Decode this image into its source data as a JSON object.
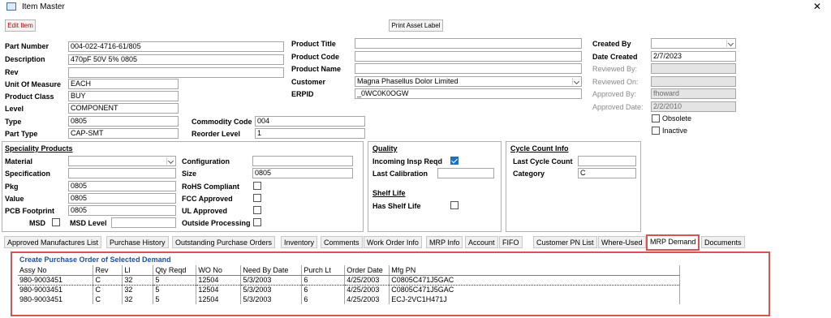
{
  "window": {
    "title": "Item Master",
    "icon": "form-icon"
  },
  "toolbar": {
    "edit_label": "Edit Item",
    "print_label": "Print Asset Label"
  },
  "item": {
    "part_number_label": "Part Number",
    "part_number": "004-022-4716-61/805",
    "description_label": "Description",
    "description": "470pF 50V 5% 0805",
    "rev_label": "Rev",
    "rev": "",
    "uom_label": "Unit Of Measure",
    "uom": "EACH",
    "product_class_label": "Product Class",
    "product_class": "BUY",
    "level_label": "Level",
    "level": "COMPONENT",
    "type_label": "Type",
    "type": "0805",
    "part_type_label": "Part Type",
    "part_type": "CAP-SMT",
    "commodity_code_label": "Commodity Code",
    "commodity_code": "004",
    "reorder_level_label": "Reorder Level",
    "reorder_level": "1"
  },
  "product": {
    "title_label": "Product Title",
    "title": "",
    "code_label": "Product Code",
    "code": "",
    "name_label": "Product Name",
    "name": "",
    "customer_label": "Customer",
    "customer": "Magna Phasellus Dolor Limited",
    "erpid_label": "ERPID",
    "erpid": "_0WC0K0OGW"
  },
  "audit": {
    "created_by_label": "Created By",
    "created_by": "",
    "date_created_label": "Date Created",
    "date_created": "2/7/2023",
    "reviewed_by_label": "Reviewed By:",
    "reviewed_by": "",
    "reviewed_on_label": "Reviewed On:",
    "reviewed_on": "",
    "approved_by_label": "Approved By:",
    "approved_by": "fhoward",
    "approved_date_label": "Approved Date:",
    "approved_date": "2/2/2010",
    "obsolete_label": "Obsolete",
    "obsolete": false,
    "inactive_label": "Inactive",
    "inactive": false
  },
  "speciality": {
    "title": "Speciality Products",
    "material_label": "Material",
    "material": "",
    "specification_label": "Specification",
    "specification": "",
    "pkg_label": "Pkg",
    "pkg": "0805",
    "value_label": "Value",
    "value": "0805",
    "pcb_footprint_label": "PCB Footprint",
    "pcb_footprint": "0805",
    "msd_label": "MSD",
    "msd": false,
    "msd_level_label": "MSD Level",
    "msd_level": "",
    "configuration_label": "Configuration",
    "configuration": "",
    "size_label": "Size",
    "size": "0805",
    "rohs_label": "RoHS Compliant",
    "rohs": false,
    "fcc_label": "FCC Approved",
    "fcc": false,
    "ul_label": "UL Approved",
    "ul": false,
    "outside_label": "Outside Processing",
    "outside": false
  },
  "quality": {
    "title": "Quality",
    "incoming_label": "Incoming Insp Reqd",
    "incoming": true,
    "last_calibration_label": "Last Calibration",
    "last_calibration": "",
    "shelf_life_title": "Shelf Life",
    "has_shelf_life_label": "Has Shelf Life",
    "has_shelf_life": false
  },
  "cycle_count": {
    "title": "Cycle Count Info",
    "last_count_label": "Last Cycle Count",
    "last_count": "",
    "category_label": "Category",
    "category": "C"
  },
  "tabs": [
    "Approved Manufactures List",
    "Purchase History",
    "Outstanding Purchase Orders",
    "Inventory",
    "Comments",
    "Work Order Info",
    "MRP Info",
    "Account",
    "FIFO",
    "Customer PN List",
    "Where-Used",
    "MRP Demand",
    "Documents"
  ],
  "active_tab": "MRP Demand",
  "mrp": {
    "title": "Create Purchase Order of Selected Demand",
    "columns": [
      "Assy No",
      "Rev",
      "LI",
      "Qty Reqd",
      "WO No",
      "Need By Date",
      "Purch Lt",
      "Order Date",
      "Mfg PN"
    ],
    "rows": [
      [
        "980-9003451",
        "C",
        "32",
        "5",
        "12504",
        "5/3/2003",
        "6",
        "4/25/2003",
        "C0805C471J5GAC"
      ],
      [
        "980-9003451",
        "C",
        "32",
        "5",
        "12504",
        "5/3/2003",
        "6",
        "4/25/2003",
        "C0805C471J5GAC"
      ],
      [
        "980-9003451",
        "C",
        "32",
        "5",
        "12504",
        "5/3/2003",
        "6",
        "4/25/2003",
        "ECJ-2VC1H471J"
      ]
    ]
  },
  "colors": {
    "accent_red": "#d9534f",
    "link_blue": "#1f4fa0",
    "checkbox_blue": "#1e6fc8"
  }
}
